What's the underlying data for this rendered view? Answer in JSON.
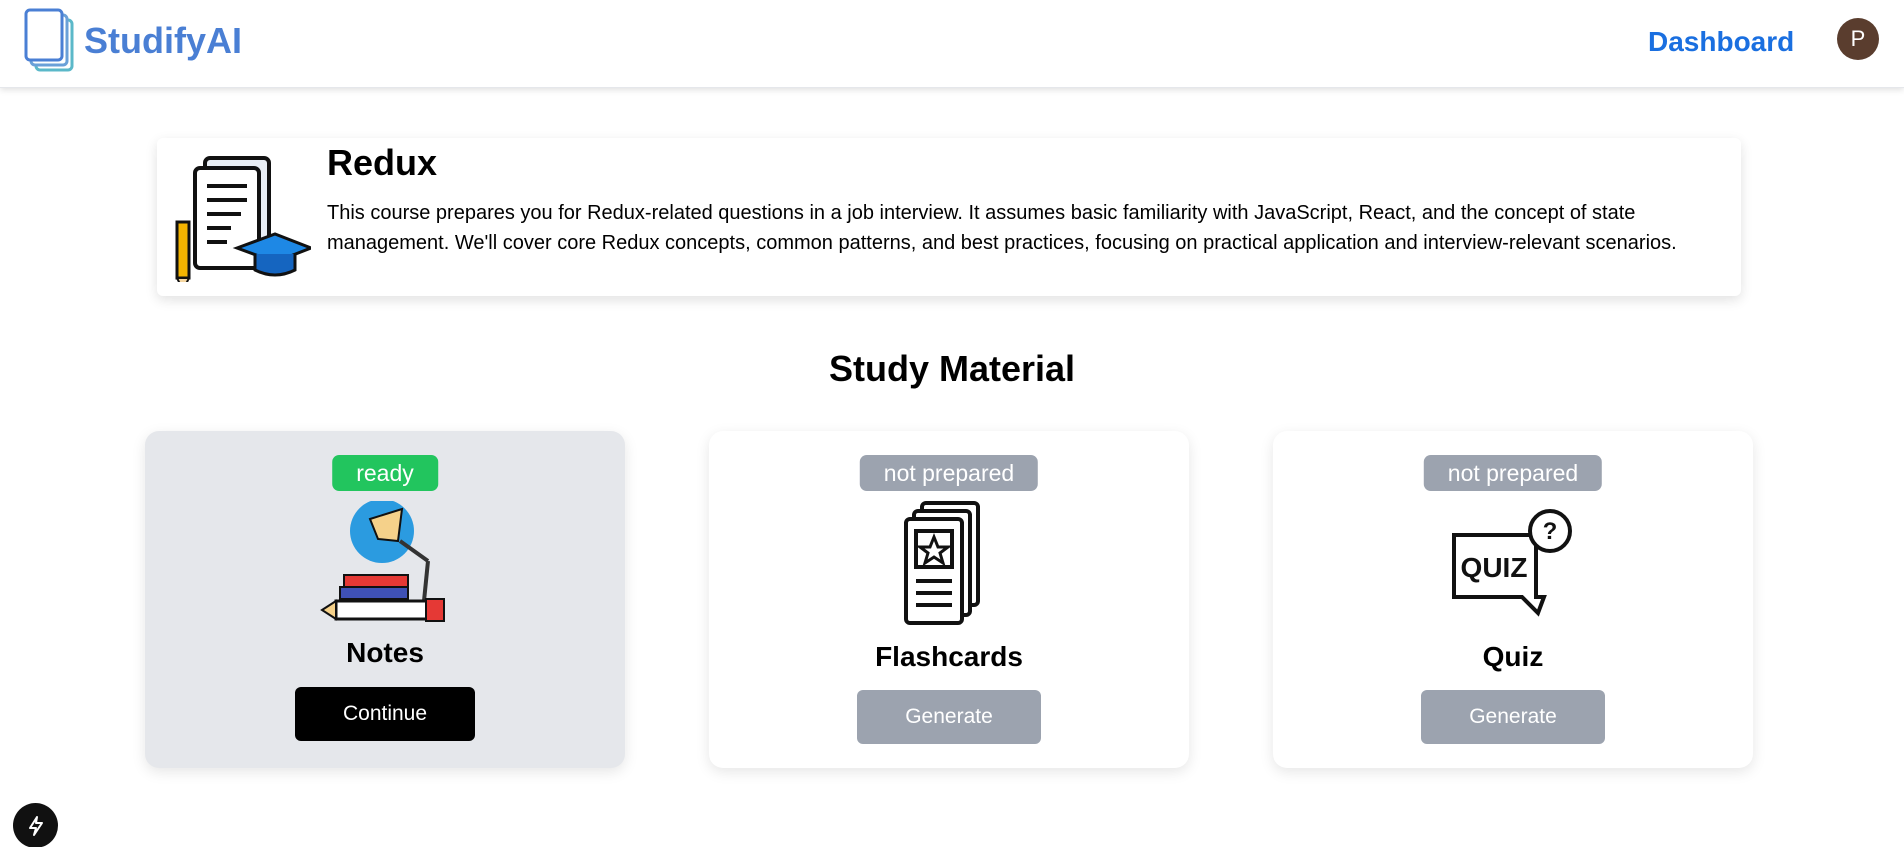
{
  "header": {
    "app_name": "StudifyAI",
    "nav_dashboard": "Dashboard",
    "avatar_initial": "P"
  },
  "course": {
    "title": "Redux",
    "description": "This course prepares you for Redux-related questions in a job interview. It assumes basic familiarity with JavaScript, React, and the concept of state management. We'll cover core Redux concepts, common patterns, and best practices, focusing on practical application and interview-relevant scenarios."
  },
  "study_material": {
    "title": "Study Material",
    "cards": [
      {
        "status": "ready",
        "title": "Notes",
        "button": "Continue",
        "icon": "notes-icon"
      },
      {
        "status": "not prepared",
        "title": "Flashcards",
        "button": "Generate",
        "icon": "flashcards-icon"
      },
      {
        "status": "not prepared",
        "title": "Quiz",
        "button": "Generate",
        "icon": "quiz-icon"
      }
    ]
  },
  "colors": {
    "brand": "#4a7fd4",
    "link": "#1a6fe0",
    "ready": "#22c55e",
    "not_prepared": "#9ca3af",
    "active_card": "#e5e7eb"
  }
}
